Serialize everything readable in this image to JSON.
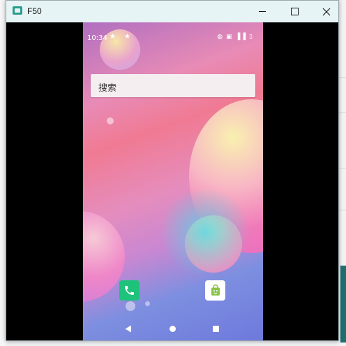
{
  "window": {
    "title": "F50",
    "buttons": {
      "minimize": "minimize",
      "maximize": "maximize",
      "close": "close"
    }
  },
  "phone": {
    "status_bar": {
      "time": "10:34",
      "icons": [
        "star-icon",
        "star-icon",
        "hotspot-icon",
        "nfc-icon",
        "signal-icon",
        "battery-icon"
      ],
      "right_text": "◍ ▣ ▐▐ ▯"
    },
    "search": {
      "label": "搜索"
    },
    "dock": [
      {
        "name": "phone-app",
        "icon": "phone-icon",
        "color": "#1ec27a"
      },
      {
        "name": "store-app",
        "icon": "shopping-bag-icon",
        "color": "#ffffff"
      }
    ],
    "nav": {
      "back": "back-icon",
      "home": "home-icon",
      "recents": "recents-icon"
    }
  },
  "colors": {
    "titlebar": "#e6f4f5",
    "phone_green": "#1ec27a"
  }
}
